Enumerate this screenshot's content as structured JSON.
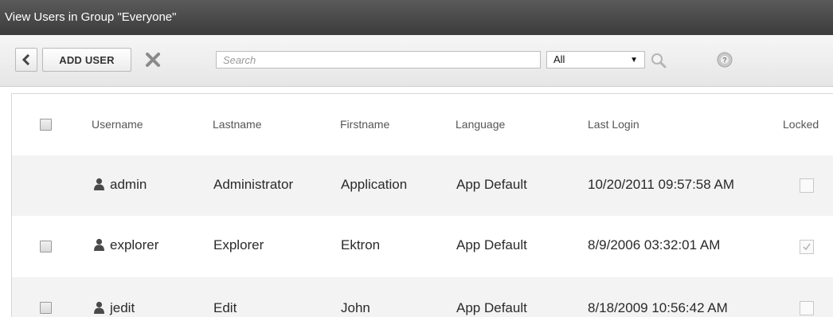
{
  "window": {
    "title": "View Users in Group \"Everyone\""
  },
  "toolbar": {
    "back_icon": "chevron-left-icon",
    "add_user_label": "ADD USER",
    "delete_icon": "x-icon",
    "search_placeholder": "Search",
    "search_value": "",
    "filter_selected": "All",
    "search_icon": "magnifier-icon",
    "help_icon": "help-icon"
  },
  "table": {
    "columns": [
      "",
      "Username",
      "Lastname",
      "Firstname",
      "Language",
      "Last Login",
      "Locked"
    ],
    "rows": [
      {
        "username": "admin",
        "lastname": "Administrator",
        "firstname": "Application",
        "language": "App Default",
        "last_login": "10/20/2011 09:57:58 AM",
        "locked": false,
        "selectable": false
      },
      {
        "username": "explorer",
        "lastname": "Explorer",
        "firstname": "Ektron",
        "language": "App Default",
        "last_login": "8/9/2006 03:32:01 AM",
        "locked": true,
        "selectable": true
      },
      {
        "username": "jedit",
        "lastname": "Edit",
        "firstname": "John",
        "language": "App Default",
        "last_login": "8/18/2009 10:56:42 AM",
        "locked": false,
        "selectable": true
      }
    ]
  },
  "colors": {
    "titlebar": "#484848",
    "row_alt": "#f3f3f3",
    "header_text": "#555555"
  }
}
